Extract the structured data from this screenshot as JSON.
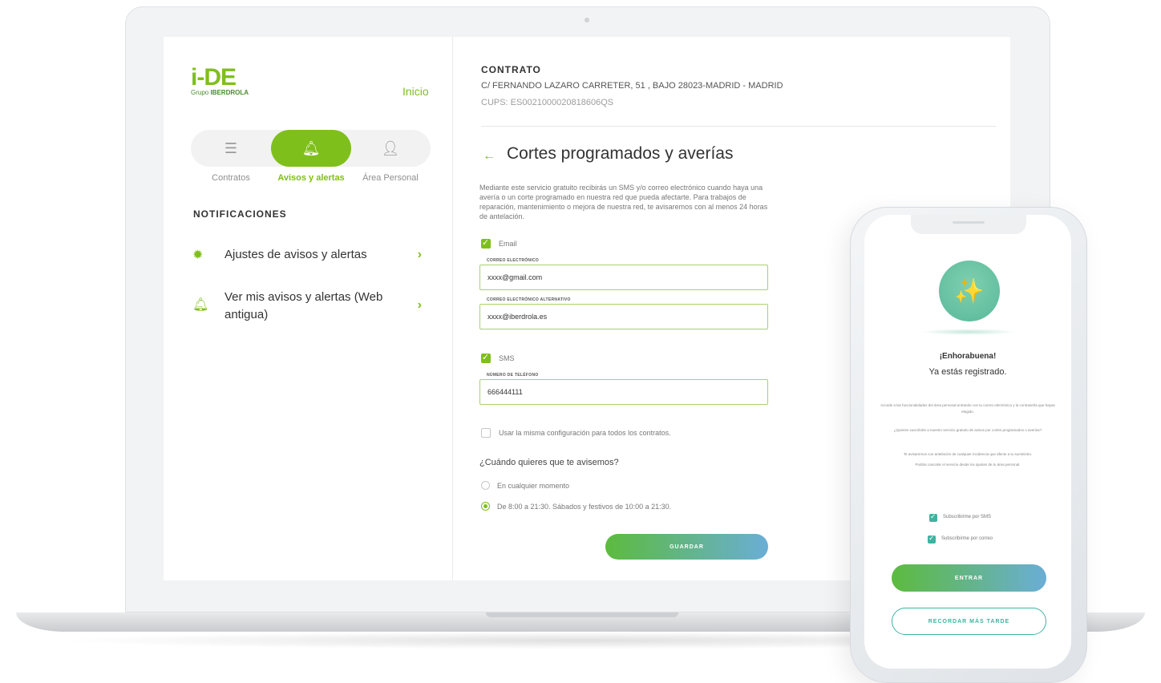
{
  "brand": {
    "logo_text": "i-DE",
    "logo_sub_prefix": "Grupo",
    "logo_sub_name": "IBERDROLA"
  },
  "sidebar": {
    "home_link": "Inicio",
    "tabs": [
      {
        "label": "Contratos",
        "icon": "list-icon"
      },
      {
        "label": "Avisos y alertas",
        "icon": "bell-icon",
        "active": true
      },
      {
        "label": "Área Personal",
        "icon": "user-icon"
      }
    ],
    "section_title": "NOTIFICACIONES",
    "menu": [
      {
        "label": "Ajustes de avisos y alertas",
        "icon": "gear-icon"
      },
      {
        "label": "Ver mis avisos y alertas (Web antigua)",
        "icon": "bell-icon"
      }
    ]
  },
  "contract": {
    "label": "CONTRATO",
    "address": "C/ FERNANDO LAZARO CARRETER, 51 , BAJO 28023-MADRID - MADRID",
    "cups": "CUPS: ES0021000020818606QS"
  },
  "main": {
    "title": "Cortes programados y averías",
    "description": "Mediante este servicio gratuito recibirás un SMS y/o correo electrónico cuando haya una avería o un corte programado en nuestra red que pueda afectarte. Para trabajos de reparación, mantenimiento o mejora de nuestra red, te avisaremos con al menos 24 horas de antelación.",
    "email_checkbox": "Email",
    "email_field_label": "CORREO ELECTRÓNICO",
    "email_value": "xxxx@gmail.com",
    "alt_email_field_label": "CORREO ELECTRÓNICO ALTERNATIVO",
    "alt_email_value": "xxxx@iberdrola.es",
    "sms_checkbox": "SMS",
    "phone_field_label": "NÚMERO DE TELÉFONO",
    "phone_value": "666444111",
    "same_config_label": "Usar la misma configuración para todos los contratos.",
    "when_question": "¿Cuándo quieres que te avisemos?",
    "radio_any": "En cualquier momento",
    "radio_schedule": "De 8:00 a 21:30. Sábados y festivos de 10:00 a 21:30.",
    "save_button": "GUARDAR"
  },
  "phone": {
    "title": "¡Enhorabuena!",
    "subtitle": "Ya estás registrado.",
    "info1": "Accede a las funcionalidades del área personal entrando con tu correo electrónico y la contraseña que hayas elegido.",
    "info2": "¿Quieres suscribirte a nuestro servicio gratuito de avisos por cortes programados o averías?",
    "info3": "Te avisaremos con antelación de cualquier incidencia que afecte a tu suministro.",
    "info4": "Podrás cancelar el servicio desde los ajustes de tu área personal.",
    "cb_sms": "Subscribirme por SMS",
    "cb_mail": "Subscribirme por correo",
    "enter_button": "ENTRAR",
    "later_button": "RECORDAR MÁS TARDE"
  },
  "colors": {
    "brand_green": "#7fbf1b",
    "teal": "#3fb3a0",
    "gradient_start": "#5cbb3e",
    "gradient_end": "#6aaed6"
  }
}
